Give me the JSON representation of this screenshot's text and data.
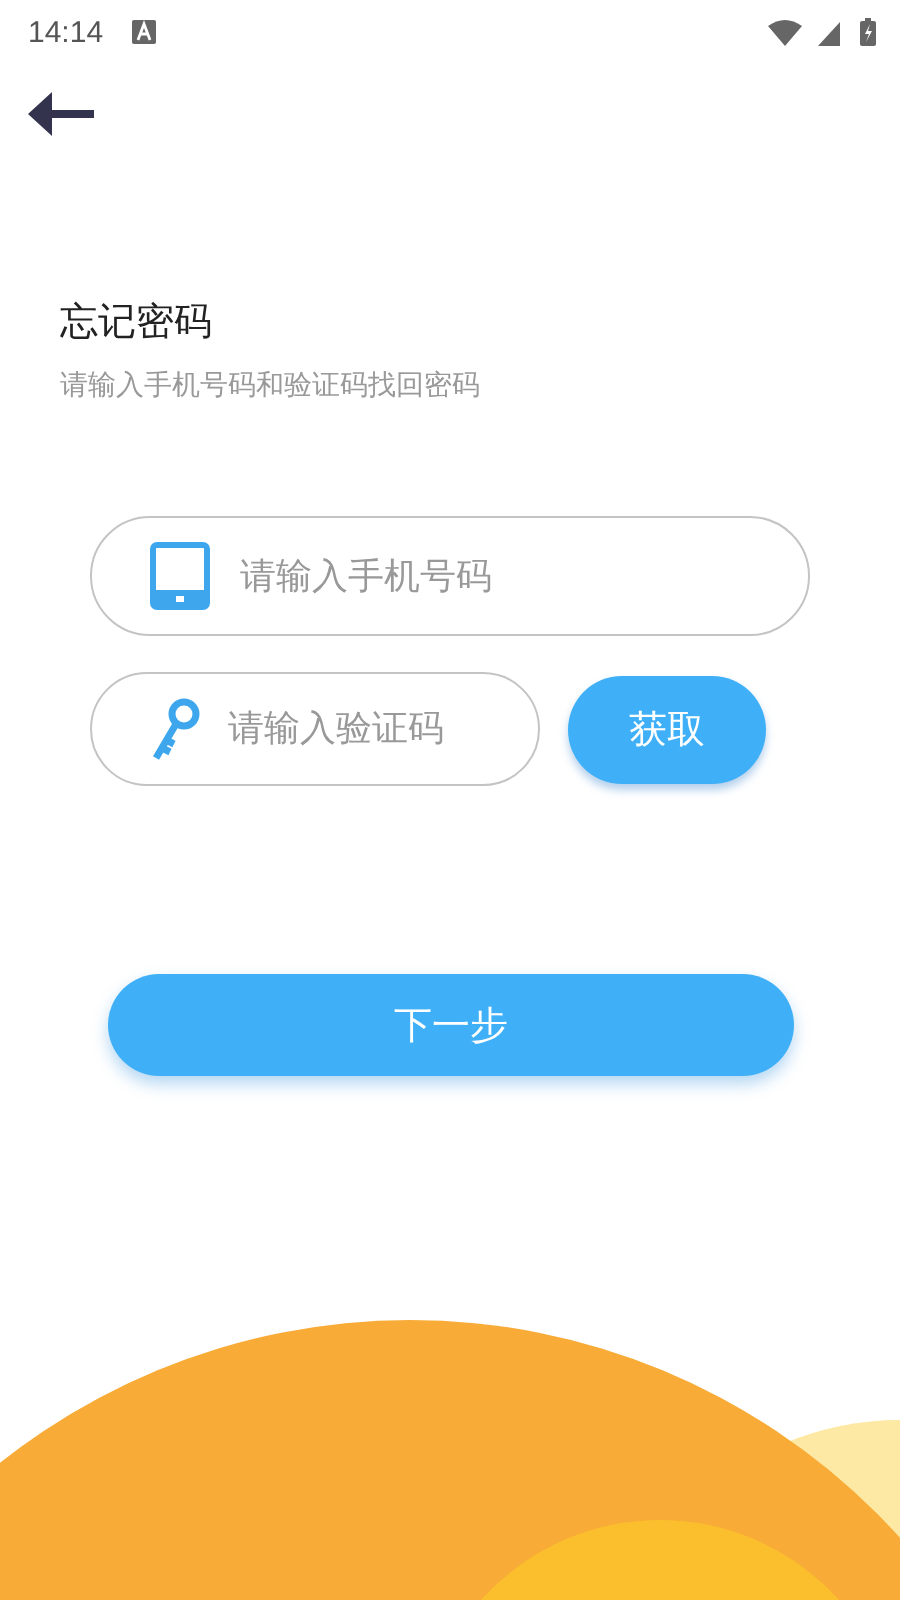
{
  "status_bar": {
    "time": "14:14"
  },
  "title": "忘记密码",
  "subtitle": "请输入手机号码和验证码找回密码",
  "phone_field": {
    "placeholder": "请输入手机号码"
  },
  "code_field": {
    "placeholder": "请输入验证码"
  },
  "get_code_button": "获取",
  "next_button": "下一步"
}
